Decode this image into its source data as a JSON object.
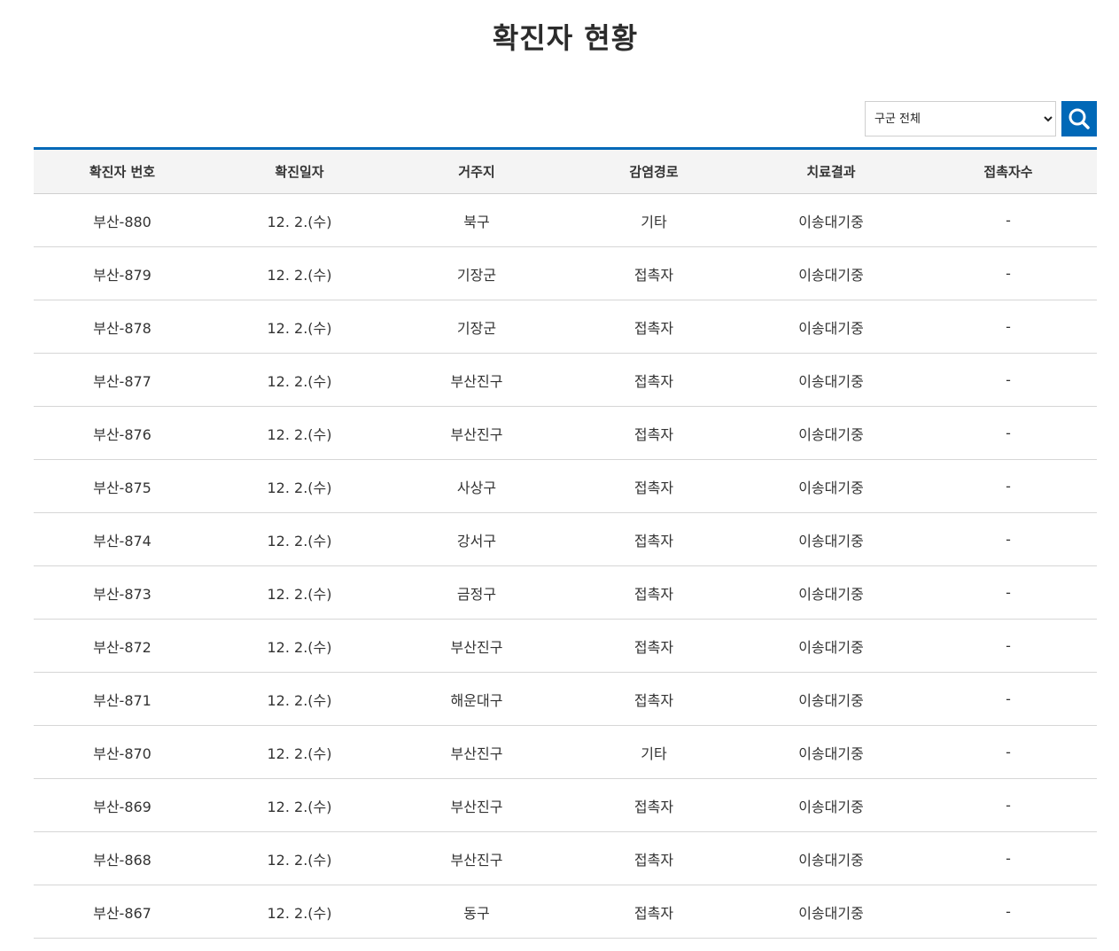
{
  "page": {
    "title": "확진자 현황"
  },
  "filter": {
    "selected_label": "구군 전체",
    "options": [
      "구군 전체"
    ],
    "search_icon": "search-icon",
    "accent_color": "#0068b7"
  },
  "table": {
    "columns": [
      "확진자 번호",
      "확진일자",
      "거주지",
      "감염경로",
      "치료결과",
      "접촉자수"
    ],
    "rows": [
      [
        "부산-880",
        "12. 2.(수)",
        "북구",
        "기타",
        "이송대기중",
        "-"
      ],
      [
        "부산-879",
        "12. 2.(수)",
        "기장군",
        "접촉자",
        "이송대기중",
        "-"
      ],
      [
        "부산-878",
        "12. 2.(수)",
        "기장군",
        "접촉자",
        "이송대기중",
        "-"
      ],
      [
        "부산-877",
        "12. 2.(수)",
        "부산진구",
        "접촉자",
        "이송대기중",
        "-"
      ],
      [
        "부산-876",
        "12. 2.(수)",
        "부산진구",
        "접촉자",
        "이송대기중",
        "-"
      ],
      [
        "부산-875",
        "12. 2.(수)",
        "사상구",
        "접촉자",
        "이송대기중",
        "-"
      ],
      [
        "부산-874",
        "12. 2.(수)",
        "강서구",
        "접촉자",
        "이송대기중",
        "-"
      ],
      [
        "부산-873",
        "12. 2.(수)",
        "금정구",
        "접촉자",
        "이송대기중",
        "-"
      ],
      [
        "부산-872",
        "12. 2.(수)",
        "부산진구",
        "접촉자",
        "이송대기중",
        "-"
      ],
      [
        "부산-871",
        "12. 2.(수)",
        "해운대구",
        "접촉자",
        "이송대기중",
        "-"
      ],
      [
        "부산-870",
        "12. 2.(수)",
        "부산진구",
        "기타",
        "이송대기중",
        "-"
      ],
      [
        "부산-869",
        "12. 2.(수)",
        "부산진구",
        "접촉자",
        "이송대기중",
        "-"
      ],
      [
        "부산-868",
        "12. 2.(수)",
        "부산진구",
        "접촉자",
        "이송대기중",
        "-"
      ],
      [
        "부산-867",
        "12. 2.(수)",
        "동구",
        "접촉자",
        "이송대기중",
        "-"
      ]
    ]
  }
}
